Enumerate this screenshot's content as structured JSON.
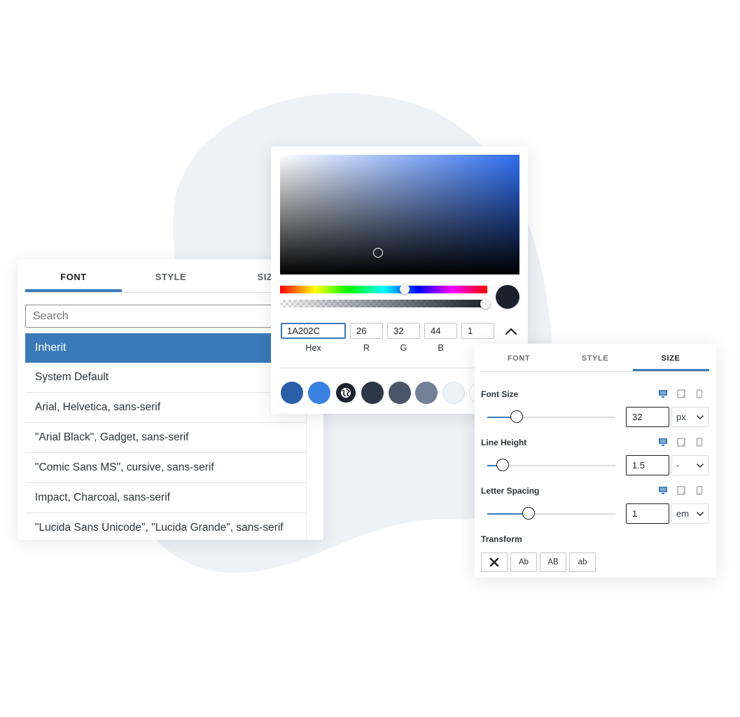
{
  "font_panel": {
    "tabs": [
      {
        "label": "FONT",
        "active": true
      },
      {
        "label": "STYLE",
        "active": false
      },
      {
        "label": "SIZE",
        "active": false
      }
    ],
    "search_placeholder": "Search",
    "fonts": [
      {
        "label": "Inherit",
        "selected": true
      },
      {
        "label": "System Default",
        "selected": false
      },
      {
        "label": "Arial, Helvetica, sans-serif",
        "selected": false
      },
      {
        "label": "\"Arial Black\", Gadget, sans-serif",
        "selected": false
      },
      {
        "label": "\"Comic Sans MS\", cursive, sans-serif",
        "selected": false
      },
      {
        "label": "Impact, Charcoal, sans-serif",
        "selected": false
      },
      {
        "label": "\"Lucida Sans Unicode\", \"Lucida Grande\", sans-serif",
        "selected": false
      }
    ]
  },
  "color_picker": {
    "hue_position": 0.6,
    "alpha_position": 1,
    "preview_color": "#1A202C",
    "hex": "1A202C",
    "r": "26",
    "g": "32",
    "b": "44",
    "a": "1",
    "labels": {
      "hex": "Hex",
      "r": "R",
      "g": "G",
      "b": "B"
    },
    "toggle_icon": "chevron-up-icon",
    "swatches": [
      {
        "color": "#2a5ea9",
        "type": "color"
      },
      {
        "color": "#3781e0",
        "type": "color"
      },
      {
        "color": "#1a202c",
        "type": "picker",
        "icon": "globe-icon"
      },
      {
        "color": "#2d3748",
        "type": "color"
      },
      {
        "color": "#4a5568",
        "type": "color"
      },
      {
        "color": "#718096",
        "type": "color"
      },
      {
        "color": "#edf2f7",
        "type": "color"
      },
      {
        "color": "#ffffff",
        "type": "color"
      }
    ]
  },
  "size_panel": {
    "tabs": [
      {
        "label": "FONT",
        "active": false
      },
      {
        "label": "STYLE",
        "active": false
      },
      {
        "label": "SIZE",
        "active": true
      }
    ],
    "devices": [
      "desktop-icon",
      "tablet-icon",
      "mobile-icon"
    ],
    "controls": [
      {
        "label": "Font Size",
        "value": "32",
        "unit": "px",
        "slider": 0.23
      },
      {
        "label": "Line Height",
        "value": "1.5",
        "unit": "-",
        "slider": 0.12
      },
      {
        "label": "Letter Spacing",
        "value": "1",
        "unit": "em",
        "slider": 0.32
      }
    ],
    "transform_label": "Transform",
    "transform_options": [
      {
        "label": "×",
        "icon": "close-icon",
        "name": "transform-none-button"
      },
      {
        "label": "Ab",
        "name": "transform-capitalize-button"
      },
      {
        "label": "AB",
        "name": "transform-uppercase-button"
      },
      {
        "label": "ab",
        "name": "transform-lowercase-button"
      }
    ]
  },
  "colors": {
    "accent": "#3a7ab9",
    "blob": "#eef1f6"
  }
}
